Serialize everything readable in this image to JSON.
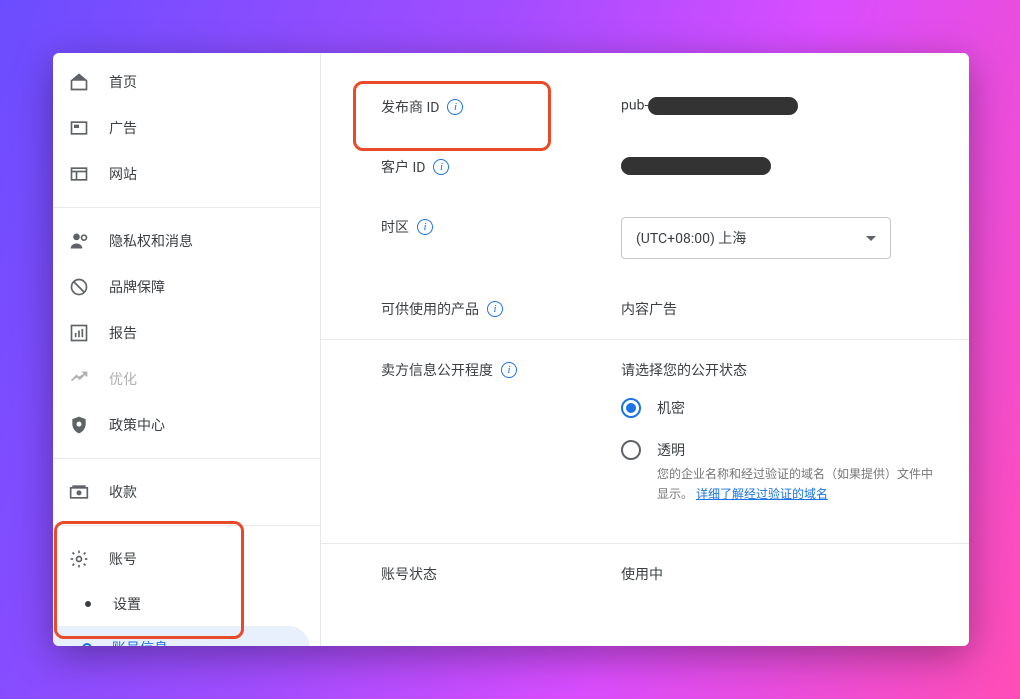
{
  "sidebar": {
    "items": [
      {
        "label": "首页"
      },
      {
        "label": "广告"
      },
      {
        "label": "网站"
      },
      {
        "label": "隐私权和消息"
      },
      {
        "label": "品牌保障"
      },
      {
        "label": "报告"
      },
      {
        "label": "优化"
      },
      {
        "label": "政策中心"
      },
      {
        "label": "收款"
      },
      {
        "label": "账号"
      }
    ],
    "sub": {
      "settings": "设置",
      "account_info": "账号信息"
    }
  },
  "content": {
    "publisher_id_label": "发布商 ID",
    "publisher_id_prefix": "pub-",
    "customer_id_label": "客户 ID",
    "timezone_label": "时区",
    "timezone_value": "(UTC+08:00) 上海",
    "products_label": "可供使用的产品",
    "products_value": "内容广告",
    "seller_info_label": "卖方信息公开程度",
    "seller_info_prompt": "请选择您的公开状态",
    "radio_confidential": "机密",
    "radio_transparent": "透明",
    "transparent_desc_part1": "您的企业名称和经过验证的域名（如果提供）文件中显示。",
    "transparent_link": "详细了解经过验证的域名",
    "account_status_label": "账号状态",
    "account_status_value": "使用中"
  }
}
